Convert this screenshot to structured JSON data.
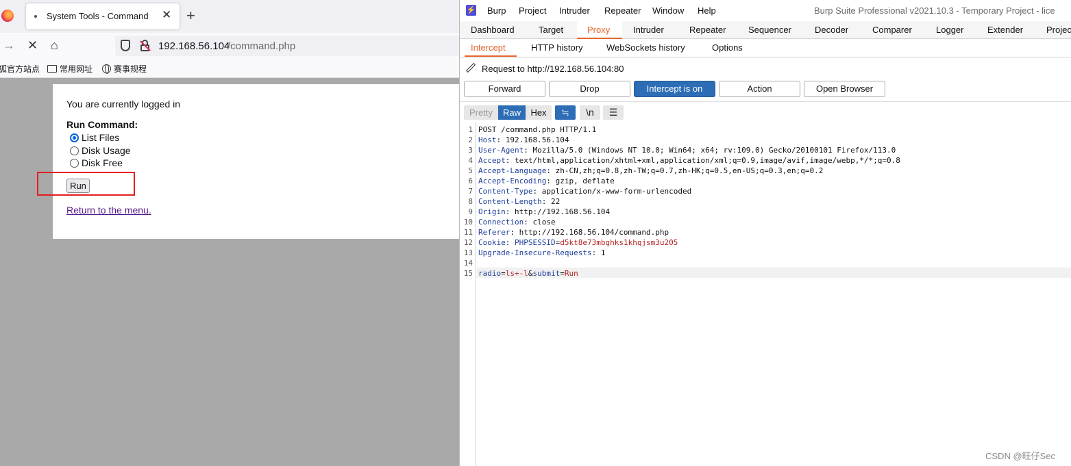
{
  "browser": {
    "tab_title": "System Tools - Command",
    "tab_close": "✕",
    "new_tab": "+",
    "url_host": "192.168.56.104",
    "url_path": "/command.php",
    "bookmarks": [
      {
        "label": "狐官方站点"
      },
      {
        "label": "常用网址"
      },
      {
        "label": "赛事规程"
      }
    ],
    "page": {
      "logged_in_text": "You are currently logged in",
      "run_command_label": "Run Command:",
      "options": [
        {
          "label": "List Files",
          "selected": true
        },
        {
          "label": "Disk Usage",
          "selected": false
        },
        {
          "label": "Disk Free",
          "selected": false
        }
      ],
      "run_button": "Run",
      "return_link": "Return to the menu."
    }
  },
  "burp": {
    "menu": [
      "Burp",
      "Project",
      "Intruder",
      "Repeater",
      "Window",
      "Help"
    ],
    "title": "Burp Suite Professional v2021.10.3 - Temporary Project - lice",
    "tabs": [
      "Dashboard",
      "Target",
      "Proxy",
      "Intruder",
      "Repeater",
      "Sequencer",
      "Decoder",
      "Comparer",
      "Logger",
      "Extender",
      "Projec"
    ],
    "active_tab": "Proxy",
    "subtabs": [
      "Intercept",
      "HTTP history",
      "WebSockets history",
      "Options"
    ],
    "active_subtab": "Intercept",
    "request_to": "Request to http://192.168.56.104:80",
    "actions": {
      "forward": "Forward",
      "drop": "Drop",
      "intercept": "Intercept is on",
      "action": "Action",
      "open_browser": "Open Browser"
    },
    "formats": {
      "pretty": "Pretty",
      "raw": "Raw",
      "hex": "Hex",
      "newline": "\\n"
    },
    "request_lines": [
      {
        "n": "1",
        "key": "",
        "val": "POST /command.php HTTP/1.1"
      },
      {
        "n": "2",
        "key": "Host",
        "val": "192.168.56.104"
      },
      {
        "n": "3",
        "key": "User-Agent",
        "val": "Mozilla/5.0 (Windows NT 10.0; Win64; x64; rv:109.0) Gecko/20100101 Firefox/113.0"
      },
      {
        "n": "4",
        "key": "Accept",
        "val": "text/html,application/xhtml+xml,application/xml;q=0.9,image/avif,image/webp,*/*;q=0.8"
      },
      {
        "n": "5",
        "key": "Accept-Language",
        "val": "zh-CN,zh;q=0.8,zh-TW;q=0.7,zh-HK;q=0.5,en-US;q=0.3,en;q=0.2"
      },
      {
        "n": "6",
        "key": "Accept-Encoding",
        "val": "gzip, deflate"
      },
      {
        "n": "7",
        "key": "Content-Type",
        "val": "application/x-www-form-urlencoded"
      },
      {
        "n": "8",
        "key": "Content-Length",
        "val": "22"
      },
      {
        "n": "9",
        "key": "Origin",
        "val": "http://192.168.56.104"
      },
      {
        "n": "10",
        "key": "Connection",
        "val": "close"
      },
      {
        "n": "11",
        "key": "Referer",
        "val": "http://192.168.56.104/command.php"
      },
      {
        "n": "12",
        "key": "Cookie",
        "val": ""
      },
      {
        "n": "13",
        "key": "Upgrade-Insecure-Requests",
        "val": "1"
      },
      {
        "n": "14",
        "key": "",
        "val": ""
      },
      {
        "n": "15",
        "key": "",
        "val": ""
      }
    ],
    "cookie": {
      "name": "PHPSESSID",
      "value": "d5kt8e73mbghks1khqjsm3u205"
    },
    "body": {
      "p1": "radio",
      "v1": "ls+-l",
      "p2": "submit",
      "v2": "Run"
    },
    "watermark": "CSDN @旺仔Sec"
  },
  "colors": {
    "accent_orange": "#e8642c",
    "burp_blue": "#2d6db5",
    "highlight_red": "#e0201f"
  }
}
